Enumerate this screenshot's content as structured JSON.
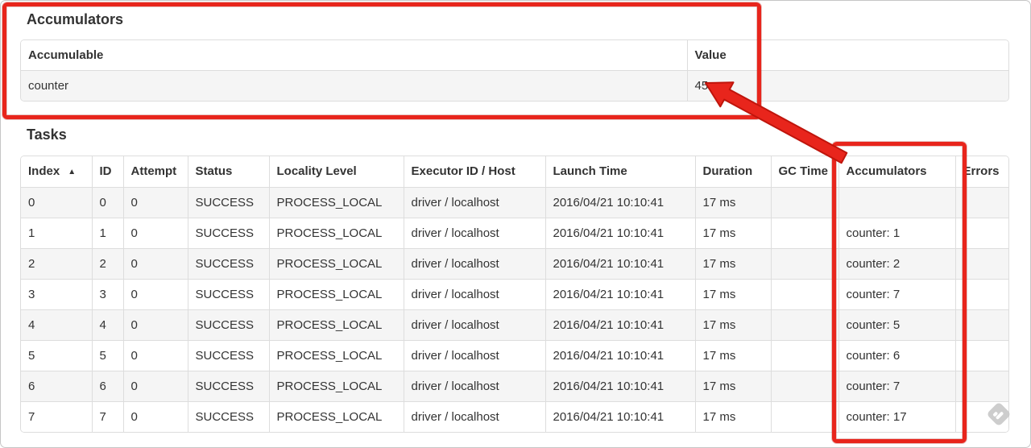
{
  "accumulators_section": {
    "heading": "Accumulators",
    "table": {
      "headers": [
        "Accumulable",
        "Value"
      ],
      "rows": [
        [
          "counter",
          "45"
        ]
      ]
    }
  },
  "tasks_section": {
    "heading": "Tasks",
    "table": {
      "sort_icon": "▲",
      "headers": [
        "Index",
        "ID",
        "Attempt",
        "Status",
        "Locality Level",
        "Executor ID / Host",
        "Launch Time",
        "Duration",
        "GC Time",
        "Accumulators",
        "Errors"
      ],
      "rows": [
        [
          "0",
          "0",
          "0",
          "SUCCESS",
          "PROCESS_LOCAL",
          "driver / localhost",
          "2016/04/21 10:10:41",
          "17 ms",
          "",
          "",
          ""
        ],
        [
          "1",
          "1",
          "0",
          "SUCCESS",
          "PROCESS_LOCAL",
          "driver / localhost",
          "2016/04/21 10:10:41",
          "17 ms",
          "",
          "counter: 1",
          ""
        ],
        [
          "2",
          "2",
          "0",
          "SUCCESS",
          "PROCESS_LOCAL",
          "driver / localhost",
          "2016/04/21 10:10:41",
          "17 ms",
          "",
          "counter: 2",
          ""
        ],
        [
          "3",
          "3",
          "0",
          "SUCCESS",
          "PROCESS_LOCAL",
          "driver / localhost",
          "2016/04/21 10:10:41",
          "17 ms",
          "",
          "counter: 7",
          ""
        ],
        [
          "4",
          "4",
          "0",
          "SUCCESS",
          "PROCESS_LOCAL",
          "driver / localhost",
          "2016/04/21 10:10:41",
          "17 ms",
          "",
          "counter: 5",
          ""
        ],
        [
          "5",
          "5",
          "0",
          "SUCCESS",
          "PROCESS_LOCAL",
          "driver / localhost",
          "2016/04/21 10:10:41",
          "17 ms",
          "",
          "counter: 6",
          ""
        ],
        [
          "6",
          "6",
          "0",
          "SUCCESS",
          "PROCESS_LOCAL",
          "driver / localhost",
          "2016/04/21 10:10:41",
          "17 ms",
          "",
          "counter: 7",
          ""
        ],
        [
          "7",
          "7",
          "0",
          "SUCCESS",
          "PROCESS_LOCAL",
          "driver / localhost",
          "2016/04/21 10:10:41",
          "17 ms",
          "",
          "counter: 17",
          ""
        ]
      ]
    }
  },
  "annotations": {
    "highlight_color": "#e8251c",
    "boxed_regions": [
      "accumulators summary table",
      "tasks accumulators column"
    ],
    "arrow_points_to": "45"
  },
  "watermark_icon": "feedly-badge"
}
